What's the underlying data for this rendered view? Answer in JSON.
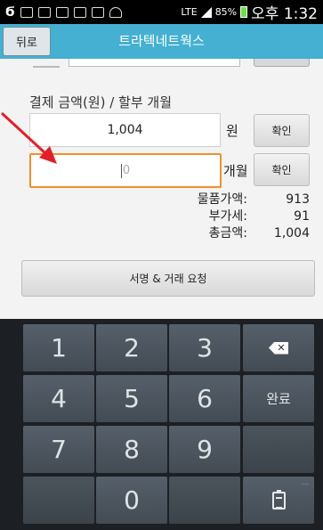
{
  "status_bar": {
    "network": "LTE",
    "battery": "85%",
    "time": "오후 1:32"
  },
  "header": {
    "back_label": "뒤로",
    "title": "트라텍네트웍스"
  },
  "form": {
    "section_label": "결제 금액(원) / 할부 개월",
    "amount_value": "1,004",
    "amount_unit": "원",
    "confirm_label": "확인",
    "installment_value": "0",
    "installment_unit": "개월"
  },
  "summary": {
    "items": [
      {
        "label": "물품가액:",
        "value": "913"
      },
      {
        "label": "부가세:",
        "value": "91"
      },
      {
        "label": "총금액:",
        "value": "1,004"
      }
    ]
  },
  "actions": {
    "request_label": "서명 & 거래 요청"
  },
  "keyboard": {
    "keys": [
      "1",
      "2",
      "3",
      "4",
      "5",
      "6",
      "7",
      "8",
      "9",
      "0"
    ],
    "done_label": "완료",
    "backspace_icon": "backspace-icon",
    "clipboard_icon": "clipboard-icon"
  },
  "colors": {
    "title_bar": "#45b0d2",
    "focus_border": "#f0902c",
    "arrow": "#e0202a",
    "keyboard_bg": "#1c2024"
  }
}
